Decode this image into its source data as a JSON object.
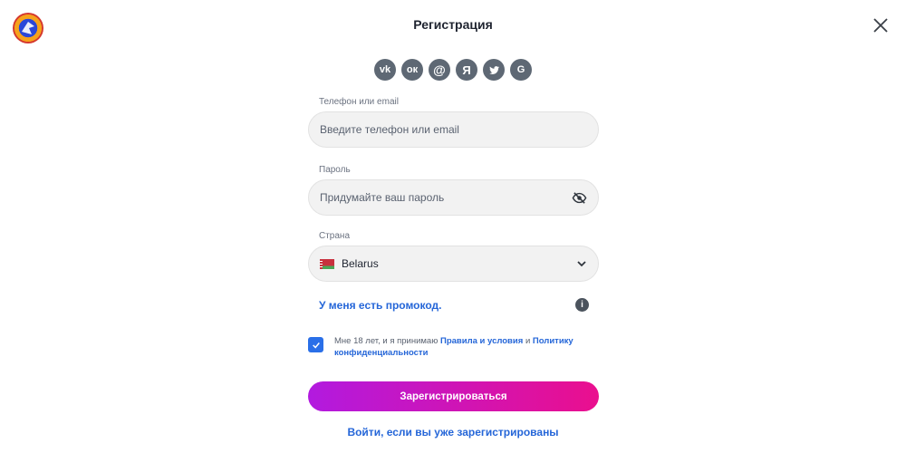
{
  "header": {
    "title": "Регистрация",
    "logo_icon": "app-logo",
    "close_icon": "close-icon"
  },
  "socials": [
    {
      "name": "vk",
      "glyph": "vk"
    },
    {
      "name": "odnoklassniki",
      "glyph": "ок"
    },
    {
      "name": "mail",
      "glyph": "@"
    },
    {
      "name": "yandex",
      "glyph": "Я"
    },
    {
      "name": "twitter",
      "glyph": "🐦"
    },
    {
      "name": "google",
      "glyph": "G"
    }
  ],
  "form": {
    "phone_label": "Телефон или email",
    "phone_placeholder": "Введите телефон или email",
    "password_label": "Пароль",
    "password_placeholder": "Придумайте ваш пароль",
    "country_label": "Страна",
    "country_value": "Belarus"
  },
  "promo": {
    "text": "У меня есть промокод.",
    "info_glyph": "i"
  },
  "consent": {
    "checked": true,
    "prefix": "Мне 18 лет, и я принимаю",
    "terms_link": "Правила и условия",
    "joiner": "и",
    "privacy_link": "Политику конфиденциальности"
  },
  "submit_label": "Зарегистрироваться",
  "login_link": "Войти, если вы уже зарегистрированы",
  "colors": {
    "accent_blue": "#2566d8",
    "gradient_start": "#b21adf",
    "gradient_end": "#ea0f8e",
    "social_bg": "#5e6874"
  }
}
